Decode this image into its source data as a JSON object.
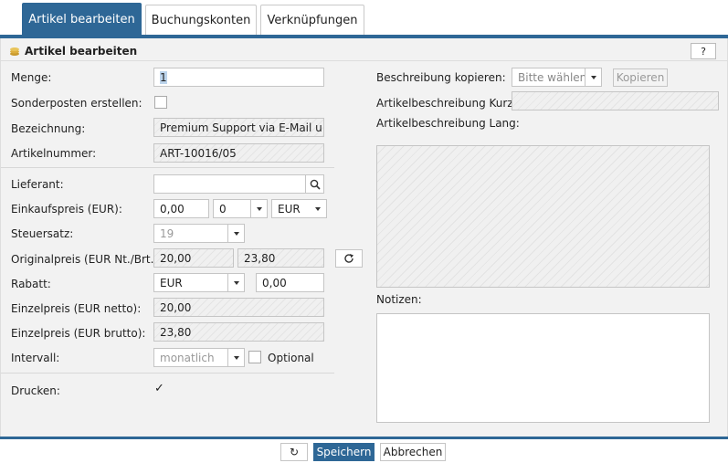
{
  "tabs": [
    {
      "label": "Artikel bearbeiten",
      "active": true
    },
    {
      "label": "Buchungskonten",
      "active": false
    },
    {
      "label": "Verknüpfungen",
      "active": false
    }
  ],
  "panel": {
    "title": "Artikel bearbeiten",
    "help_label": "?",
    "icon": "coins-icon"
  },
  "form": {
    "menge": {
      "label": "Menge:",
      "value": "1"
    },
    "sonderposten": {
      "label": "Sonderposten erstellen:",
      "checked": false
    },
    "bezeichnung": {
      "label": "Bezeichnung:",
      "value": "Premium Support via E-Mail u ..."
    },
    "artikelnummer": {
      "label": "Artikelnummer:",
      "value": "ART-10016/05"
    },
    "lieferant": {
      "label": "Lieferant:",
      "value": ""
    },
    "einkaufspreis": {
      "label": "Einkaufspreis (EUR):",
      "value": "0,00",
      "select_value": "0",
      "currency": "EUR"
    },
    "steuersatz": {
      "label": "Steuersatz:",
      "value": "19"
    },
    "originalpreis": {
      "label": "Originalpreis (EUR Nt./Brt.):",
      "netto": "20,00",
      "brutto": "23,80"
    },
    "rabatt": {
      "label": "Rabatt:",
      "type": "EUR",
      "value": "0,00"
    },
    "einzelpreis_netto": {
      "label": "Einzelpreis (EUR netto):",
      "value": "20,00"
    },
    "einzelpreis_brutto": {
      "label": "Einzelpreis (EUR brutto):",
      "value": "23,80"
    },
    "intervall": {
      "label": "Intervall:",
      "value": "monatlich",
      "optional_label": "Optional"
    },
    "drucken": {
      "label": "Drucken:",
      "check_glyph": "✓"
    }
  },
  "right": {
    "beschreibung_kopieren": {
      "label": "Beschreibung kopieren:",
      "placeholder": "Bitte wählen",
      "button": "Kopieren"
    },
    "kurz_label": "Artikelbeschreibung Kurz:",
    "lang_label": "Artikelbeschreibung Lang:",
    "notizen_label": "Notizen:"
  },
  "footer": {
    "refresh_icon": "↻",
    "save": "Speichern",
    "cancel": "Abbrechen"
  },
  "colors": {
    "accent": "#2e6796"
  }
}
